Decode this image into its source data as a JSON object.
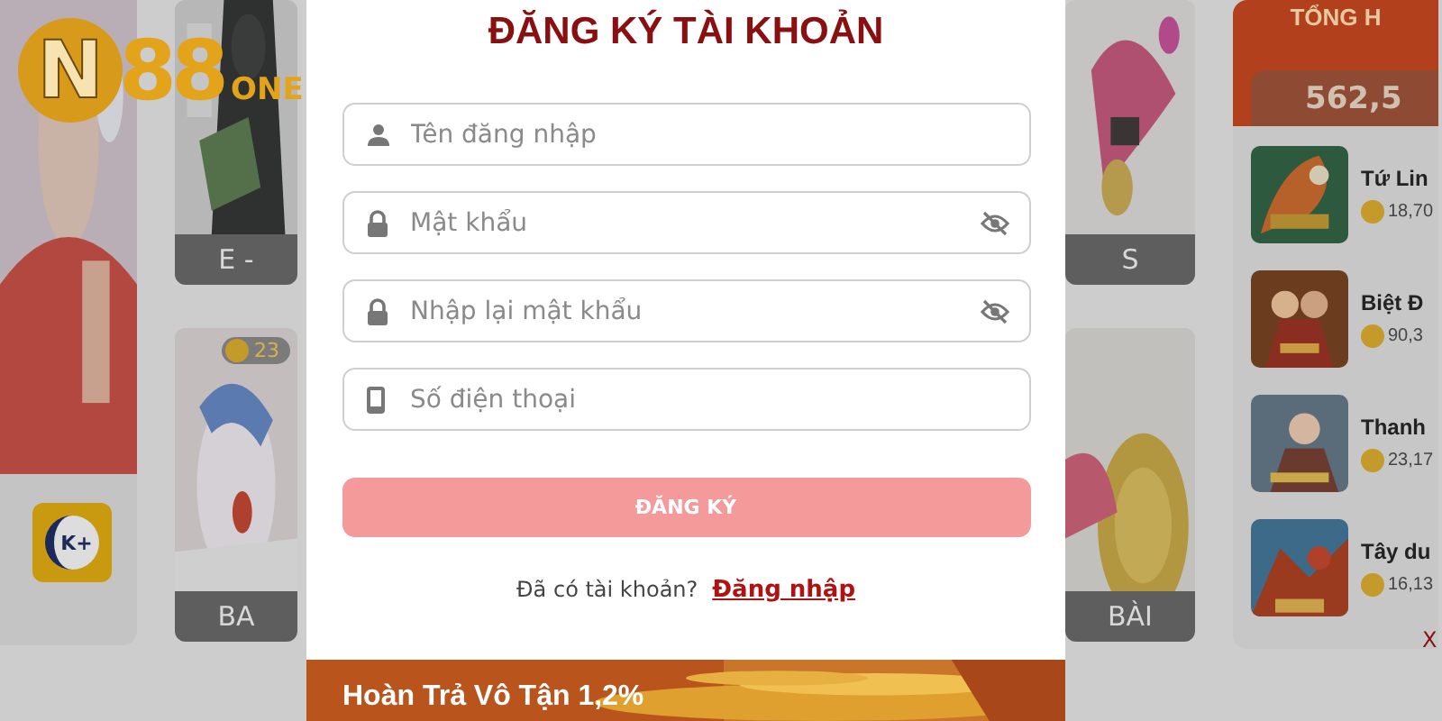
{
  "logo": {
    "mark": "N",
    "text": "88",
    "suffix": "ONE"
  },
  "left_column": {
    "badge": "K+"
  },
  "game_cards_left": [
    {
      "label": "E -"
    },
    {
      "label": "BA",
      "coin": "23"
    }
  ],
  "game_cards_right": [
    {
      "label": "S"
    },
    {
      "label": "BÀI"
    }
  ],
  "jackpot": {
    "title": "TỔNG H",
    "amount": "562,5"
  },
  "winners": [
    {
      "name": "Tứ Lin",
      "amount": "18,70"
    },
    {
      "name": "Biệt Đ",
      "amount": "90,3"
    },
    {
      "name": "Thanh",
      "amount": "23,17"
    },
    {
      "name": "Tây du",
      "amount": "16,13"
    }
  ],
  "more_link": "X",
  "modal": {
    "title": "ĐĂNG KÝ TÀI KHOẢN",
    "fields": [
      {
        "kind": "username",
        "placeholder": "Tên đăng nhập"
      },
      {
        "kind": "password",
        "placeholder": "Mật khẩu"
      },
      {
        "kind": "password",
        "placeholder": "Nhập lại mật khẩu"
      },
      {
        "kind": "phone",
        "placeholder": "Số điện thoại"
      }
    ],
    "submit": {
      "label": "ĐĂNG KÝ",
      "disabled": true
    },
    "login_prompt": "Đã có tài khoản?",
    "login_link": "Đăng nhập",
    "banner": {
      "kind": "picture",
      "text": "Hoàn Trả Vô Tận 1,2%"
    }
  }
}
